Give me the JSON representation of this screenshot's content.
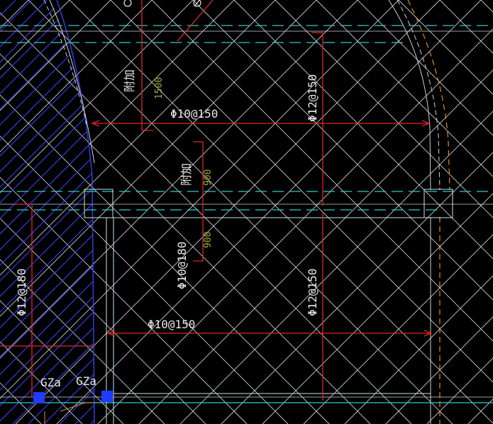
{
  "palette": {
    "background": "#000000",
    "hatch": "#cfcfcf",
    "rebar": "#e0262a",
    "axis_cyan": "#34c9c9",
    "slab_edge": "#bfe8e8",
    "arc_blue": "#2f3fe0",
    "dash_orange": "#e08a2a",
    "column": "#1e3cff",
    "text_white": "#e8e8e8",
    "text_green": "#9aab3a"
  },
  "annotations": {
    "top_fujia": "附加",
    "top_len": "1500",
    "top_horiz": "Φ10@150",
    "top_right_vert": "Φ12@150",
    "mid_fujia": "附加",
    "mid_len_upper": "900",
    "mid_len_lower": "900",
    "mid_vert": "Φ10@180",
    "right_vert_lower": "Φ12@150",
    "left_vert": "Φ12@180",
    "bottom_horiz": "Φ10@150",
    "col_label_1": "GZa",
    "col_label_2": "GZa"
  }
}
